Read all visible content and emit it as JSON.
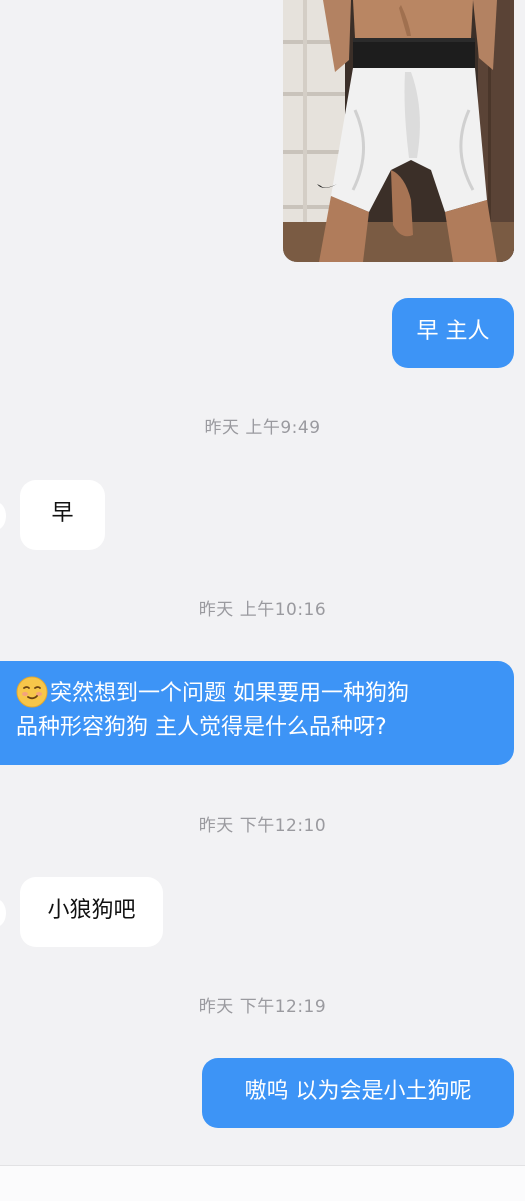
{
  "messages": [
    {
      "id": "m1",
      "type": "image",
      "side": "outgoing"
    },
    {
      "id": "m2",
      "side": "outgoing",
      "text": "早 主人"
    },
    {
      "id": "t1",
      "type": "timestamp",
      "text": "昨天 上午9:49"
    },
    {
      "id": "m3",
      "side": "incoming",
      "text": "早"
    },
    {
      "id": "t2",
      "type": "timestamp",
      "text": "昨天 上午10:16"
    },
    {
      "id": "m4",
      "side": "outgoing",
      "emoji": "smirk-face",
      "line1": "突然想到一个问题 如果要用一种狗狗",
      "line2": "品种形容狗狗 主人觉得是什么品种呀?"
    },
    {
      "id": "t3",
      "type": "timestamp",
      "text": "昨天 下午12:10"
    },
    {
      "id": "m5",
      "side": "incoming",
      "text": "小狼狗吧"
    },
    {
      "id": "t4",
      "type": "timestamp",
      "text": "昨天 下午12:19"
    },
    {
      "id": "m6",
      "side": "outgoing",
      "text": "嗷呜 以为会是小土狗呢"
    }
  ],
  "colors": {
    "background": "#f2f2f4",
    "outgoing_bubble": "#3d94f6",
    "incoming_bubble": "#ffffff",
    "timestamp_text": "#9a9a9f"
  }
}
